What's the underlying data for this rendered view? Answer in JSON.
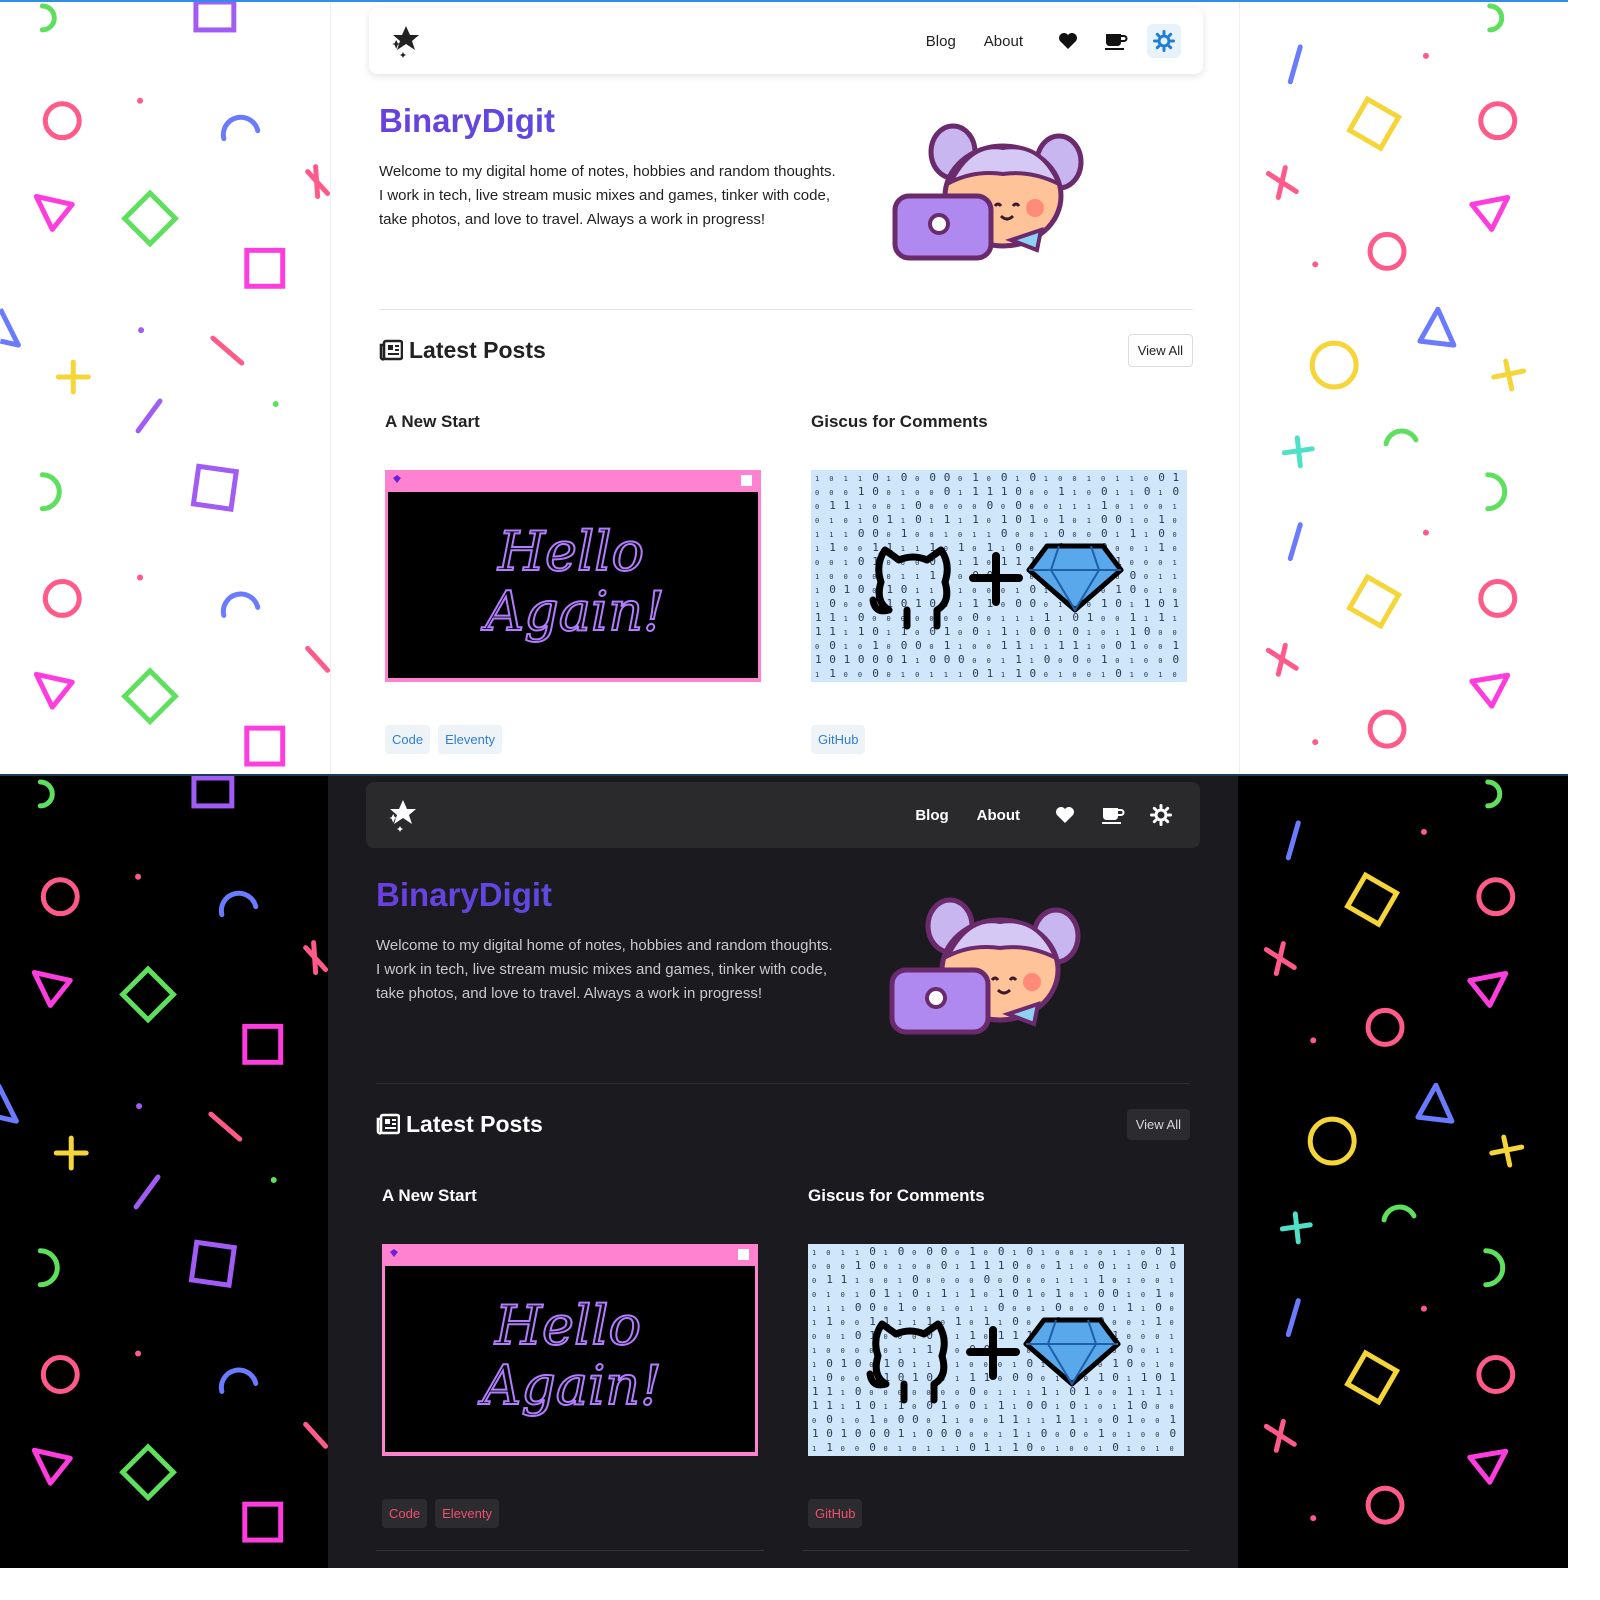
{
  "nav": {
    "links": [
      "Blog",
      "About"
    ],
    "icons": [
      "heart-icon",
      "coffee-icon",
      "theme-toggle-icon"
    ]
  },
  "hero": {
    "title": "BinaryDigit",
    "text": "Welcome to my digital home of notes, hobbies and random thoughts. I work in tech, live stream music mixes and games, tinker with code, take photos, and love to travel. Always a work in progress!"
  },
  "latest": {
    "title": "Latest Posts",
    "view_all": "View All"
  },
  "posts": [
    {
      "title": "A New Start",
      "image_text": [
        "Hello",
        "Again!"
      ],
      "tags": [
        "Code",
        "Eleventy"
      ]
    },
    {
      "title": "Giscus for Comments",
      "tags": [
        "GitHub"
      ]
    }
  ],
  "colors": {
    "title_gradient_start": "#6a3fe0",
    "title_gradient_end": "#2f72d8",
    "light_tag_text": "#2f7fd0",
    "dark_tag_text": "#f0506e",
    "dark_background": "#1b1a1e"
  }
}
